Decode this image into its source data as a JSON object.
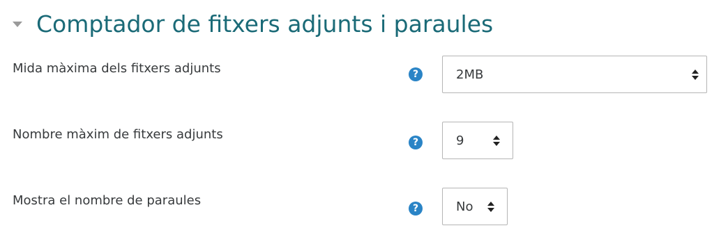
{
  "section": {
    "title": "Comptador de fitxers adjunts i paraules",
    "collapse_icon": "triangle-down-icon"
  },
  "colors": {
    "title": "#1a6a77",
    "help_icon": "#2a84c6",
    "select_border": "#b5b5b5"
  },
  "fields": [
    {
      "label": "Mida màxima dels fitxers adjunts",
      "help_icon": "question-circle-icon",
      "help_glyph": "?",
      "value": "2MB"
    },
    {
      "label": "Nombre màxim de fitxers adjunts",
      "help_icon": "question-circle-icon",
      "help_glyph": "?",
      "value": "9"
    },
    {
      "label": "Mostra el nombre de paraules",
      "help_icon": "question-circle-icon",
      "help_glyph": "?",
      "value": "No"
    }
  ]
}
